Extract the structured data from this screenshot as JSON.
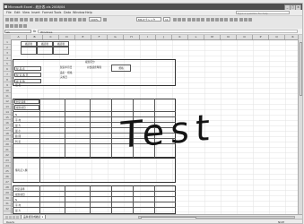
{
  "window": {
    "title": "Microsoft Excel - 統計表.xls 2008/04",
    "minimize": "_",
    "maximize": "□",
    "close": "×"
  },
  "menu": {
    "items": [
      "File",
      "Edit",
      "View",
      "Insert",
      "Format",
      "Tools",
      "Data",
      "Window",
      "Help"
    ],
    "help_placeholder": "Type a question for help"
  },
  "toolbar": {
    "font_name": "MS Pゴシック",
    "font_size": "11",
    "zoom": "100%"
  },
  "formula_bar": {
    "name_box": "A1",
    "fx": "fx",
    "value": "Windows"
  },
  "columns": [
    "A",
    "B",
    "C",
    "D",
    "E",
    "F",
    "G",
    "H",
    "I",
    "J",
    "K",
    "L",
    "M",
    "N",
    "O",
    "P",
    "Q",
    "R"
  ],
  "rows": [
    "1",
    "2",
    "3",
    "4",
    "5",
    "6",
    "7",
    "8",
    "9",
    "10",
    "11",
    "12",
    "13",
    "14",
    "15",
    "16",
    "17",
    "18",
    "19",
    "20",
    "21",
    "22",
    "23",
    "24",
    "25",
    "26",
    "27",
    "28",
    "29",
    "30",
    "31",
    "32"
  ],
  "form": {
    "top_labels": [
      "確認者",
      "確認者",
      "確認者"
    ],
    "section_small_1": "検査区分",
    "section_small_2": "担当検査時間",
    "field_1": "製造年月日",
    "field_2": "規格",
    "field_3": "品名・規格",
    "field_4": "実施日",
    "field_5": "製 品 名",
    "field_6": "製 造 番 号",
    "field_7": "検 査 数",
    "field_8": "検 査",
    "block1_label": "判定基準",
    "block1_sub": "検査項目",
    "rows_a": [
      "N",
      "平 均",
      "最 大",
      "最 小",
      "範 囲",
      "判 定"
    ],
    "block2_label": "備考記入欄",
    "block3_label": "判定基準",
    "rows_b": [
      "検査項目",
      "N",
      "平 均",
      "最 大"
    ]
  },
  "overlay_text": "Test",
  "sheet_tabs": {
    "active": "品質検査成績表 1",
    "others": []
  },
  "status": {
    "left": "Ready",
    "right": "NUM"
  }
}
